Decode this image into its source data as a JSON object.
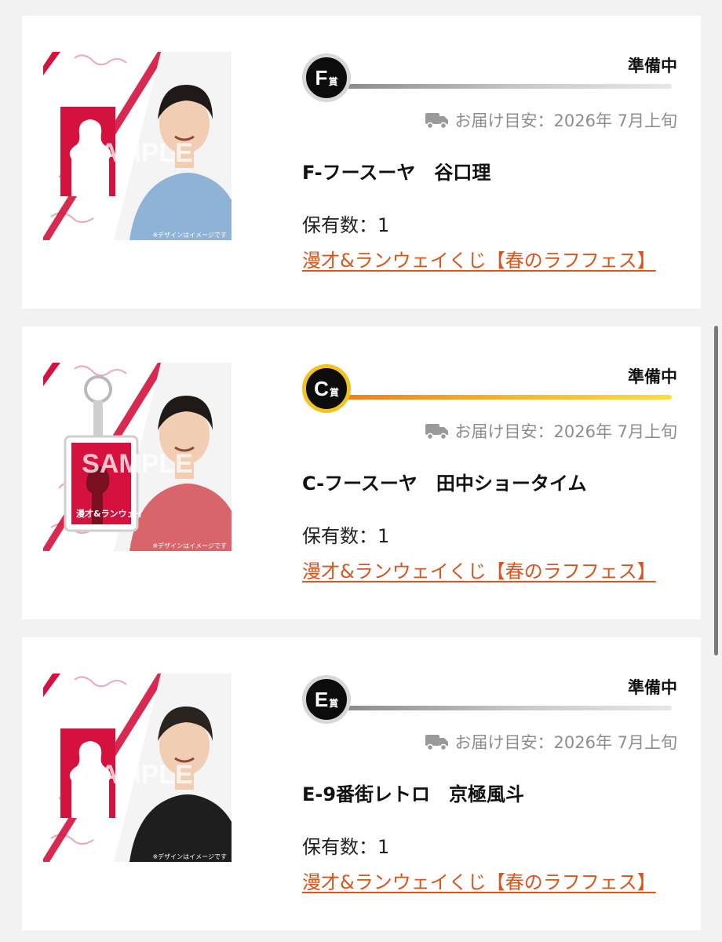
{
  "items": [
    {
      "badge_letter": "F",
      "badge_sub": "賞",
      "status": "準備中",
      "delivery_label": "お届け目安：2026年 7月上旬",
      "name": "F-フースーヤ　谷口理",
      "count_label": "保有数：1",
      "link_text": "漫才&ランウェイくじ【春のラフフェス】",
      "thumbnail": {
        "watermark": "SAMPLE",
        "caption": "※デザインはイメージです",
        "shirt_color": "#8fb3d6",
        "keychain": false
      },
      "theme": "silver",
      "icon": "truck-icon"
    },
    {
      "badge_letter": "C",
      "badge_sub": "賞",
      "status": "準備中",
      "delivery_label": "お届け目安：2026年 7月上旬",
      "name": "C-フースーヤ　田中ショータイム",
      "count_label": "保有数：1",
      "link_text": "漫才&ランウェイくじ【春のラフフェス】",
      "thumbnail": {
        "watermark": "SAMPLE",
        "caption": "※デザインはイメージです",
        "shirt_color": "#d9656c",
        "keychain": true,
        "keychain_text": "漫才&ランウェイ"
      },
      "theme": "gold",
      "icon": "truck-icon"
    },
    {
      "badge_letter": "E",
      "badge_sub": "賞",
      "status": "準備中",
      "delivery_label": "お届け目安：2026年 7月上旬",
      "name": "E-9番街レトロ　京極風斗",
      "count_label": "保有数：1",
      "link_text": "漫才&ランウェイくじ【春のラフフェス】",
      "thumbnail": {
        "watermark": "SAMPLE",
        "caption": "※デザインはイメージです",
        "shirt_color": "#1e1e1e",
        "keychain": false
      },
      "theme": "silver",
      "icon": "truck-icon"
    }
  ],
  "colors": {
    "accent_red": "#d4123d",
    "link_orange": "#d9551e",
    "muted_gray": "#8d8d8d",
    "gold": "#f4c21f"
  }
}
